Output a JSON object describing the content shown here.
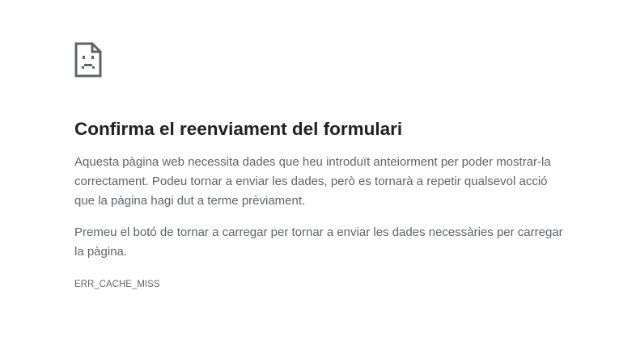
{
  "error_page": {
    "icon": "sad-page-icon",
    "title": "Confirma el reenviament del formulari",
    "paragraph_1": "Aquesta pàgina web necessita dades que heu introduït anteiorment per poder mostrar-la correctament. Podeu tornar a enviar les dades, però es tornarà a repetir qualsevol acció que la pàgina hagi dut a terme prèviament.",
    "paragraph_2": "Premeu el botó de tornar a carregar per tornar a enviar les dades necessàries per carregar la pàgina.",
    "error_code": "ERR_CACHE_MISS"
  },
  "colors": {
    "title": "#202124",
    "body_text": "#5f6368",
    "icon": "#5f6368",
    "background": "#ffffff"
  }
}
